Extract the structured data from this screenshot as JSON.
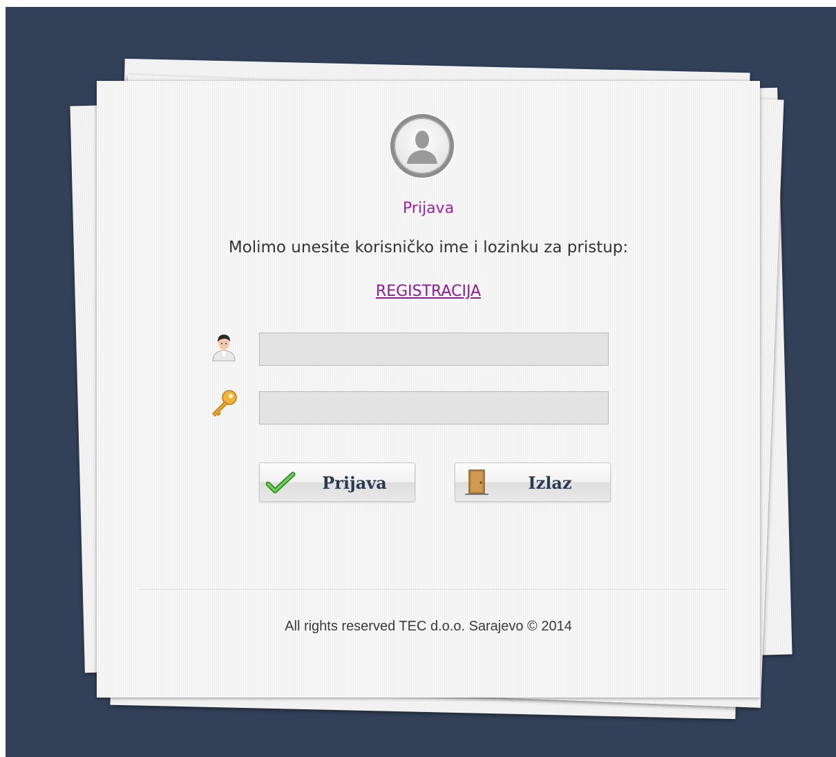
{
  "login": {
    "title": "Prijava",
    "instruction": "Molimo unesite korisničko ime i lozinku za pristup:",
    "register_link": "REGISTRACIJA",
    "username": {
      "icon": "user-icon",
      "value": "",
      "placeholder": ""
    },
    "password": {
      "icon": "key-icon",
      "value": "",
      "placeholder": ""
    },
    "buttons": {
      "login_label": "Prijava",
      "login_icon": "checkmark-icon",
      "exit_label": "Izlaz",
      "exit_icon": "door-icon"
    },
    "footer": "All rights reserved TEC d.o.o. Sarajevo © 2014"
  },
  "colors": {
    "background": "#324058",
    "title": "#a020a8",
    "link": "#8a1d8f",
    "button_text": "#2a3a52"
  }
}
